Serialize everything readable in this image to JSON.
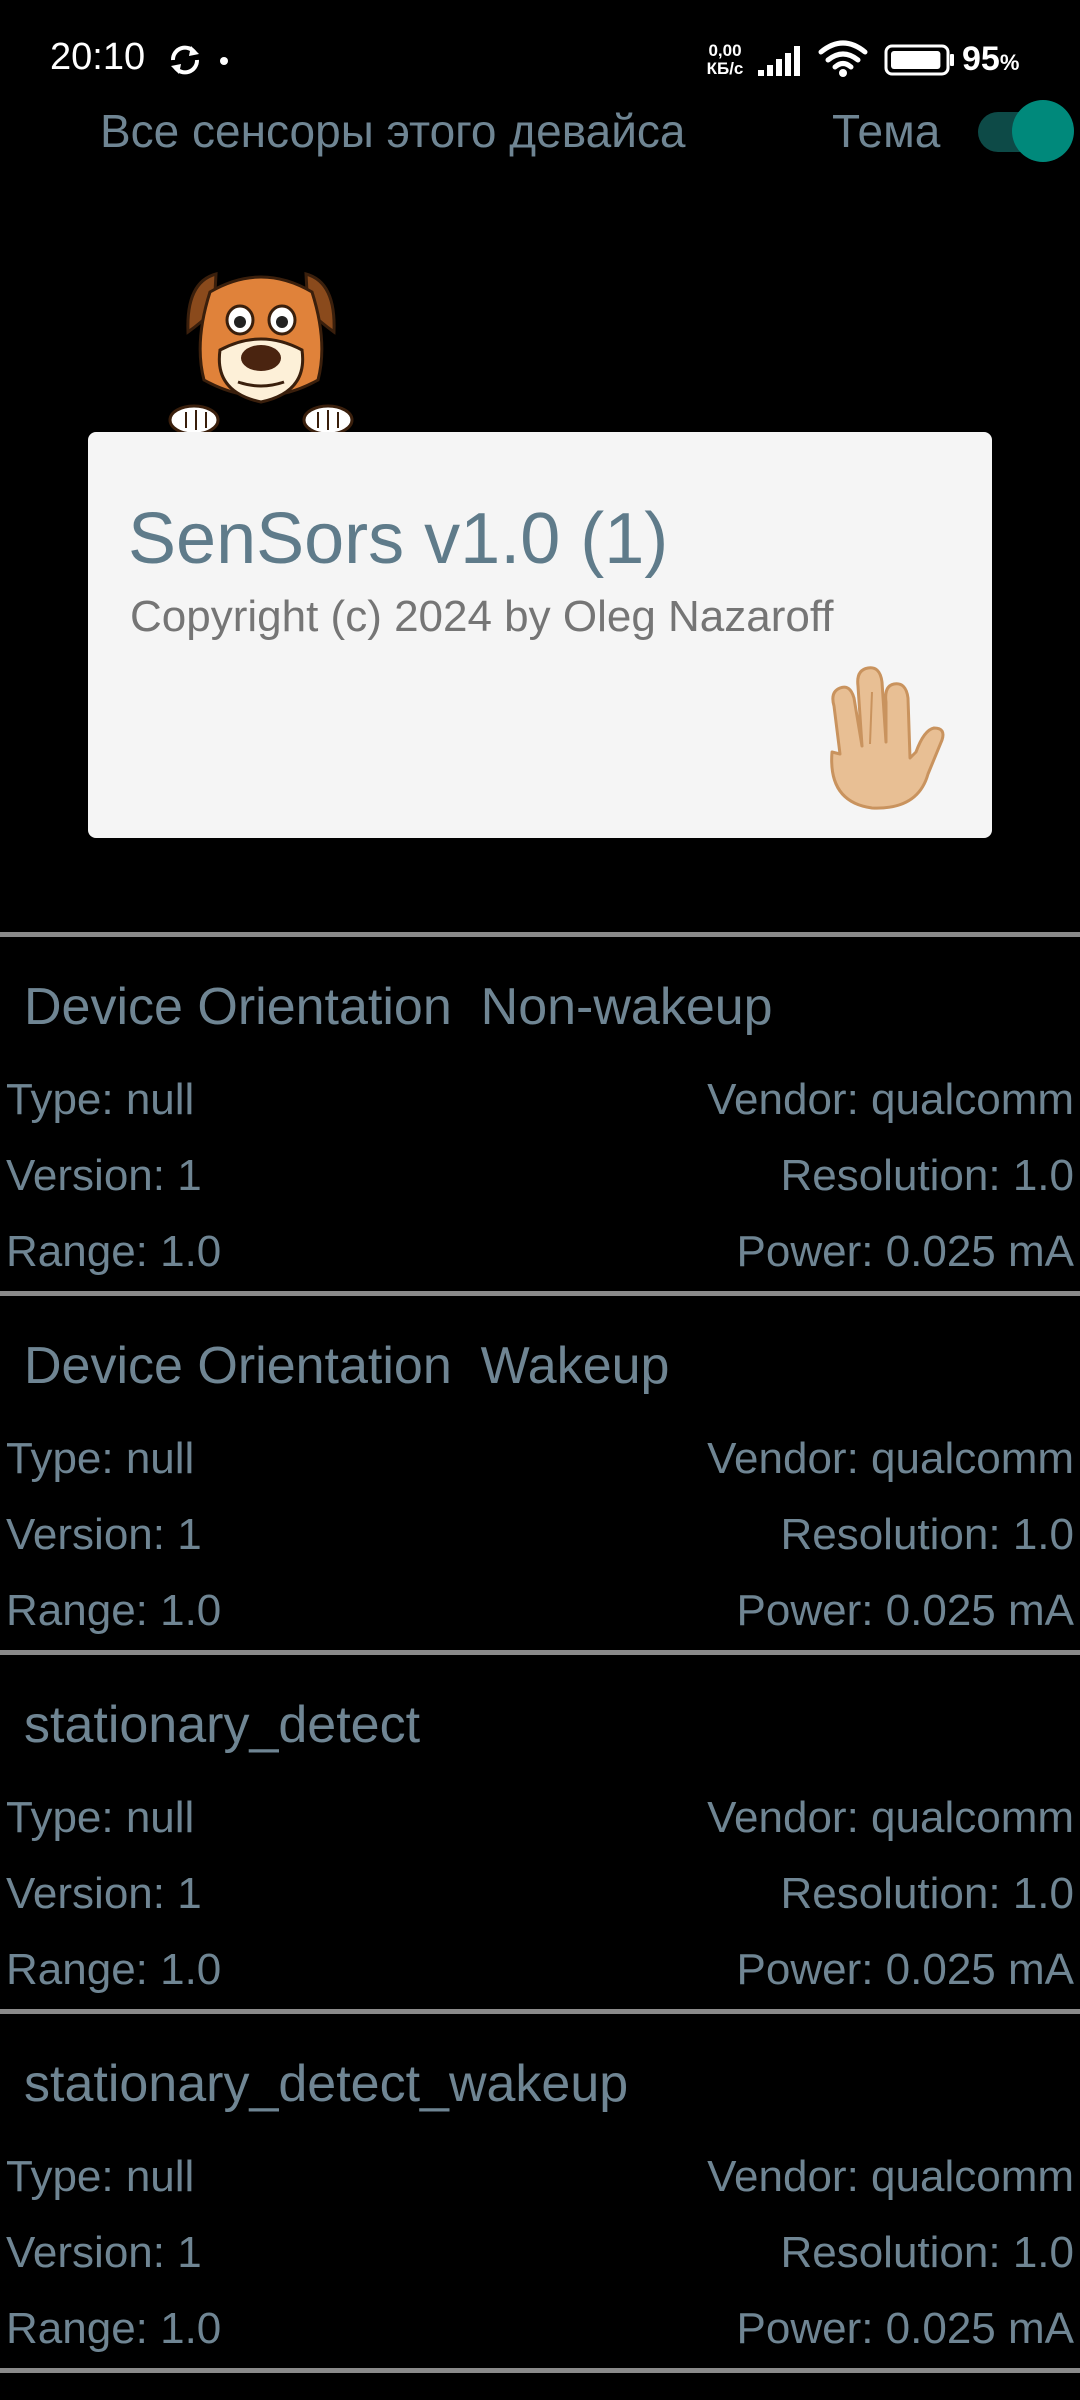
{
  "status_bar": {
    "time": "20:10",
    "net_speed_value": "0,00",
    "net_speed_unit": "КБ/с",
    "battery_percent": "95",
    "battery_unit": "%",
    "battery_level": 0.95,
    "icons": [
      "sync-icon",
      "dot-icon",
      "signal-icon",
      "wifi-icon",
      "battery-icon"
    ]
  },
  "header": {
    "title": "Все сенсоры этого девайса",
    "theme_label": "Тема",
    "theme_toggle_on": true
  },
  "about": {
    "title": "SenSors v1.0 (1)",
    "copyright": "Copyright (c) 2024 by Oleg Nazaroff",
    "icons": [
      "dog-mascot",
      "vulcan-salute-icon"
    ]
  },
  "sensors": [
    {
      "name": "Device Orientation  Non-wakeup",
      "type": "Type: null",
      "vendor": "Vendor: qualcomm",
      "version": "Version: 1",
      "resolution": "Resolution: 1.0",
      "range": "Range: 1.0",
      "power": "Power: 0.025 mA"
    },
    {
      "name": "Device Orientation  Wakeup",
      "type": "Type: null",
      "vendor": "Vendor: qualcomm",
      "version": "Version: 1",
      "resolution": "Resolution: 1.0",
      "range": "Range: 1.0",
      "power": "Power: 0.025 mA"
    },
    {
      "name": "stationary_detect",
      "type": "Type: null",
      "vendor": "Vendor: qualcomm",
      "version": "Version: 1",
      "resolution": "Resolution: 1.0",
      "range": "Range: 1.0",
      "power": "Power: 0.025 mA"
    },
    {
      "name": "stationary_detect_wakeup",
      "type": "Type: null",
      "vendor": "Vendor: qualcomm",
      "version": "Version: 1",
      "resolution": "Resolution: 1.0",
      "range": "Range: 1.0",
      "power": "Power: 0.025 mA"
    }
  ],
  "colors": {
    "background": "#000000",
    "text_muted": "#6f8593",
    "card_bg": "#f5f5f5",
    "accent": "#00897b",
    "divider": "#8a8a8a"
  }
}
